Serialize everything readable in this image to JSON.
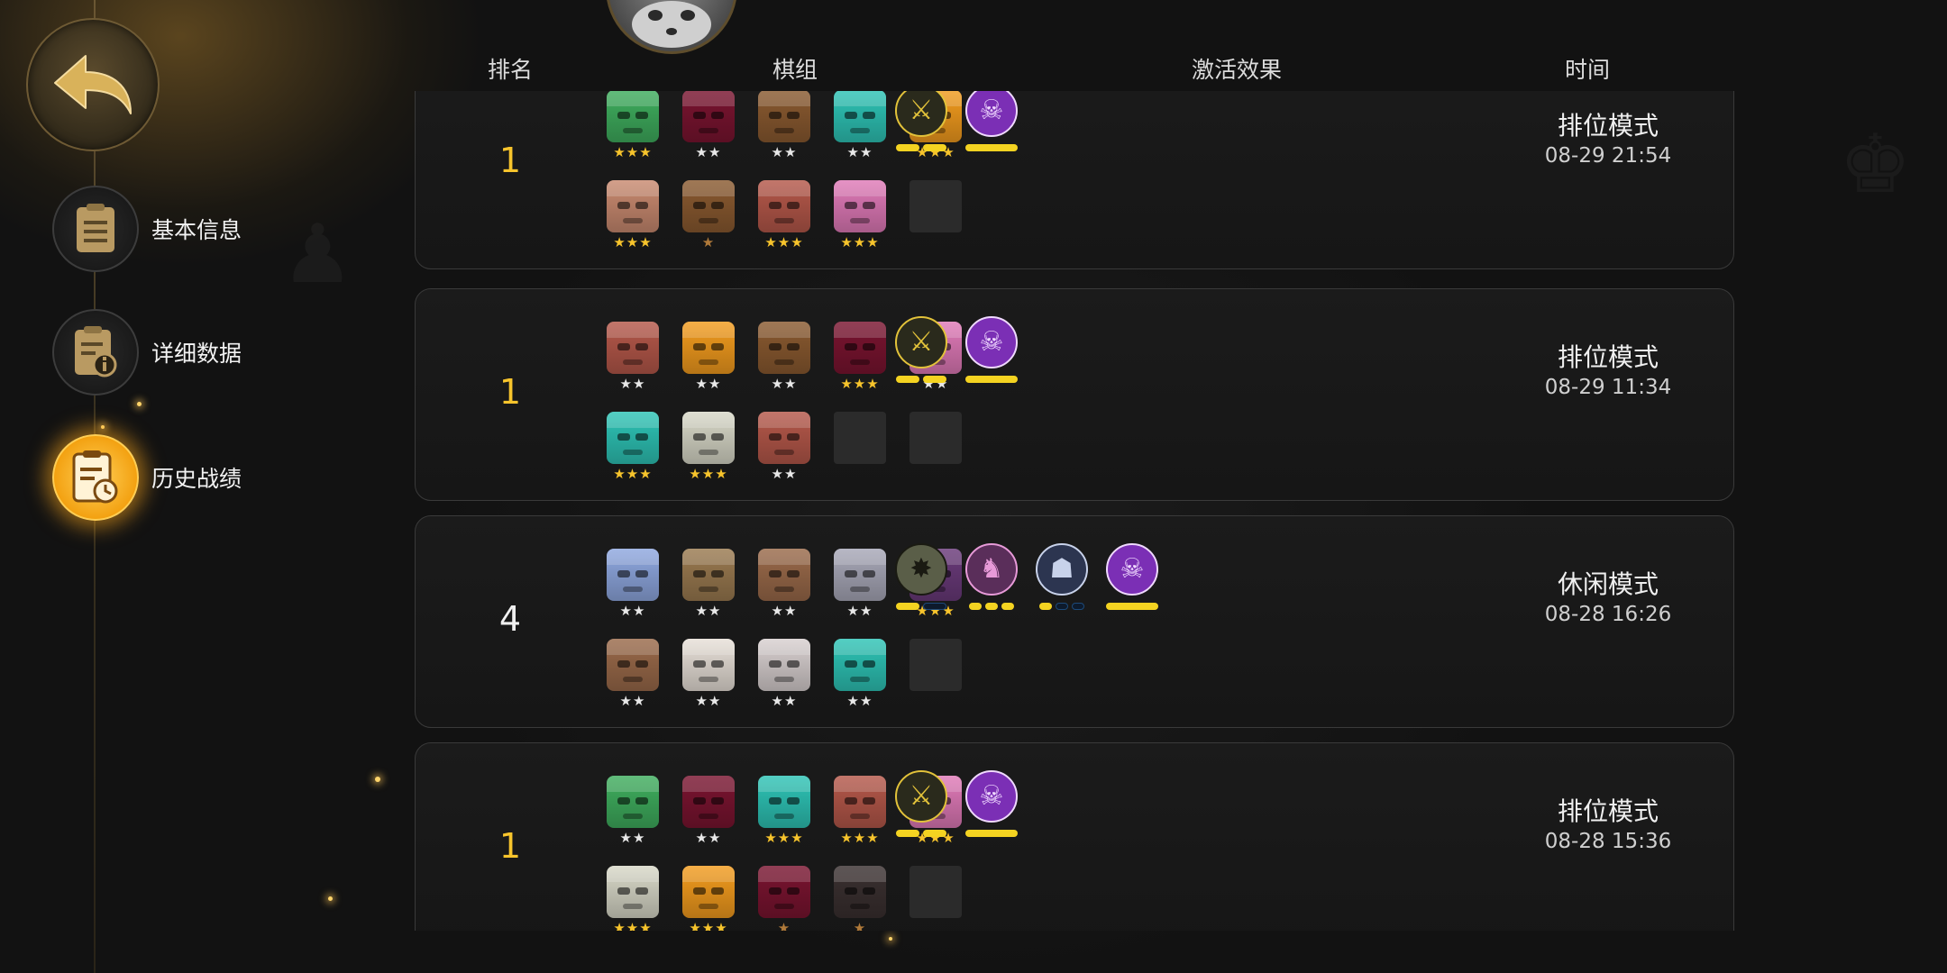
{
  "nav": {
    "back": "back-arrow",
    "items": [
      {
        "label": "基本信息",
        "icon": "document-icon",
        "active": false
      },
      {
        "label": "详细数据",
        "icon": "info-document-icon",
        "active": false
      },
      {
        "label": "历史战绩",
        "icon": "history-clock-icon",
        "active": true
      }
    ]
  },
  "columns": {
    "rank": "排名",
    "team": "棋组",
    "traits": "激活效果",
    "time": "时间"
  },
  "colors": {
    "gold": "#f7c42c",
    "active_nav": "#f3a111",
    "card_border": "#3a3a3a"
  },
  "matches": [
    {
      "rank": "1",
      "mode": "排位模式",
      "time": "08-29 21:54",
      "pieces": [
        {
          "color": "#3fae5e",
          "stars": "★★★",
          "tier": 3
        },
        {
          "color": "#7a1430",
          "stars": "★★",
          "tier": 2
        },
        {
          "color": "#8a5a30",
          "stars": "★★",
          "tier": 2
        },
        {
          "color": "#2ec4b6",
          "stars": "★★",
          "tier": 2
        },
        {
          "color": "#f39c1e",
          "stars": "★★★",
          "tier": 3
        },
        {
          "color": "#c98a70",
          "stars": "★★★",
          "tier": 3
        },
        {
          "color": "#8a5a30",
          "stars": "★",
          "tier": 1
        },
        {
          "color": "#b5584a",
          "stars": "★★★",
          "tier": 3
        },
        {
          "color": "#e07ab8",
          "stars": "★★★",
          "tier": 3
        },
        null
      ],
      "traits": [
        {
          "icon": "swords-icon",
          "glyph": "⚔",
          "bg": "#2a2a1c",
          "fg": "#e2c23a",
          "bars": [
            1,
            1
          ],
          "widths": [
            26,
            26
          ]
        },
        {
          "icon": "skull-icon",
          "glyph": "☠",
          "bg": "#7b2fb5",
          "fg": "#f0d9ff",
          "bars": [
            1
          ],
          "widths": [
            58
          ]
        }
      ]
    },
    {
      "rank": "1",
      "mode": "排位模式",
      "time": "08-29 11:34",
      "pieces": [
        {
          "color": "#b5584a",
          "stars": "★★",
          "tier": 2
        },
        {
          "color": "#f39c1e",
          "stars": "★★",
          "tier": 2
        },
        {
          "color": "#8a5a30",
          "stars": "★★",
          "tier": 2
        },
        {
          "color": "#7a1430",
          "stars": "★★★",
          "tier": 3
        },
        {
          "color": "#e07ab8",
          "stars": "★★",
          "tier": 2
        },
        {
          "color": "#2ec4b6",
          "stars": "★★★",
          "tier": 3
        },
        {
          "color": "#d8d8c8",
          "stars": "★★★",
          "tier": 3
        },
        {
          "color": "#b5584a",
          "stars": "★★",
          "tier": 2
        },
        null,
        null
      ],
      "traits": [
        {
          "icon": "swords-icon",
          "glyph": "⚔",
          "bg": "#2a2a1c",
          "fg": "#e2c23a",
          "bars": [
            1,
            1
          ],
          "widths": [
            26,
            26
          ]
        },
        {
          "icon": "skull-icon",
          "glyph": "☠",
          "bg": "#7b2fb5",
          "fg": "#f0d9ff",
          "bars": [
            1
          ],
          "widths": [
            58
          ]
        }
      ]
    },
    {
      "rank": "4",
      "mode": "休闲模式",
      "time": "08-28 16:26",
      "pieces": [
        {
          "color": "#8fa8e0",
          "stars": "★★",
          "tier": 2
        },
        {
          "color": "#9a7a50",
          "stars": "★★",
          "tier": 2
        },
        {
          "color": "#9a6a4a",
          "stars": "★★",
          "tier": 2
        },
        {
          "color": "#a8a8b8",
          "stars": "★★",
          "tier": 2
        },
        {
          "color": "#6a3a7a",
          "stars": "★★★",
          "tier": 3
        },
        {
          "color": "#9a6a4a",
          "stars": "★★",
          "tier": 2
        },
        {
          "color": "#e8e0d8",
          "stars": "★★",
          "tier": 2
        },
        {
          "color": "#d8d0d0",
          "stars": "★★",
          "tier": 2
        },
        {
          "color": "#2ec4b6",
          "stars": "★★",
          "tier": 2
        },
        null
      ],
      "traits": [
        {
          "icon": "beast-icon",
          "glyph": "✸",
          "bg": "#5a5e48",
          "fg": "#1a1a12",
          "bars": [
            1,
            0
          ],
          "widths": [
            26,
            26
          ]
        },
        {
          "icon": "knight-icon",
          "glyph": "♞",
          "bg": "#5a2e5a",
          "fg": "#e79ad8",
          "bars": [
            1,
            1,
            1
          ],
          "widths": [
            14,
            14,
            14
          ]
        },
        {
          "icon": "mask-icon",
          "glyph": "☗",
          "bg": "#2c3550",
          "fg": "#c8d2ea",
          "bars": [
            1,
            0,
            0
          ],
          "widths": [
            14,
            14,
            14
          ]
        },
        {
          "icon": "skull-icon",
          "glyph": "☠",
          "bg": "#7b2fb5",
          "fg": "#f0d9ff",
          "bars": [
            1
          ],
          "widths": [
            58
          ]
        }
      ]
    },
    {
      "rank": "1",
      "mode": "排位模式",
      "time": "08-28 15:36",
      "pieces": [
        {
          "color": "#3fae5e",
          "stars": "★★",
          "tier": 2
        },
        {
          "color": "#7a1430",
          "stars": "★★",
          "tier": 2
        },
        {
          "color": "#2ec4b6",
          "stars": "★★★",
          "tier": 3
        },
        {
          "color": "#b5584a",
          "stars": "★★★",
          "tier": 3
        },
        {
          "color": "#e07ab8",
          "stars": "★★★",
          "tier": 3
        },
        {
          "color": "#d8d8c8",
          "stars": "★★★",
          "tier": 3
        },
        {
          "color": "#f39c1e",
          "stars": "★★★",
          "tier": 3
        },
        {
          "color": "#7a1430",
          "stars": "★",
          "tier": 1
        },
        {
          "color": "#3a3030",
          "stars": "★",
          "tier": 1
        },
        null
      ],
      "traits": [
        {
          "icon": "swords-icon",
          "glyph": "⚔",
          "bg": "#2a2a1c",
          "fg": "#e2c23a",
          "bars": [
            1,
            1
          ],
          "widths": [
            26,
            26
          ]
        },
        {
          "icon": "skull-icon",
          "glyph": "☠",
          "bg": "#7b2fb5",
          "fg": "#f0d9ff",
          "bars": [
            1
          ],
          "widths": [
            58
          ]
        }
      ]
    }
  ]
}
